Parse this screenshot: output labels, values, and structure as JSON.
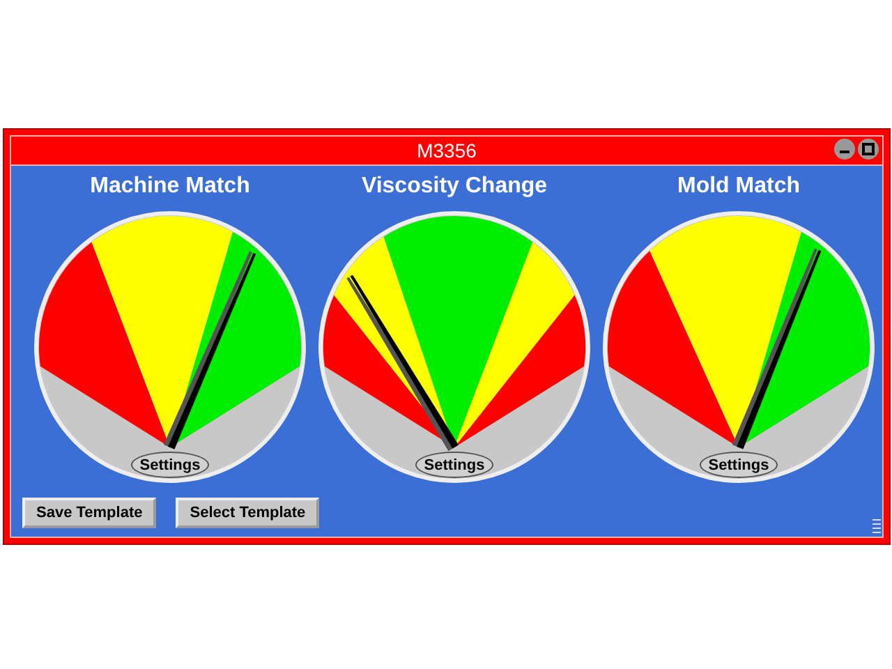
{
  "window": {
    "title": "M3356"
  },
  "gauges": [
    {
      "title": "Machine Match",
      "settings": "Settings",
      "needle": {
        "level": 0.7
      }
    },
    {
      "title": "Viscosity Change",
      "settings": "Settings",
      "needle": {
        "level": 0.23
      }
    },
    {
      "title": "Mold Match",
      "settings": "Settings",
      "needle": {
        "level": 0.69
      }
    }
  ],
  "buttons": [
    {
      "label": "Save Template"
    },
    {
      "label": "Select Template"
    }
  ]
}
